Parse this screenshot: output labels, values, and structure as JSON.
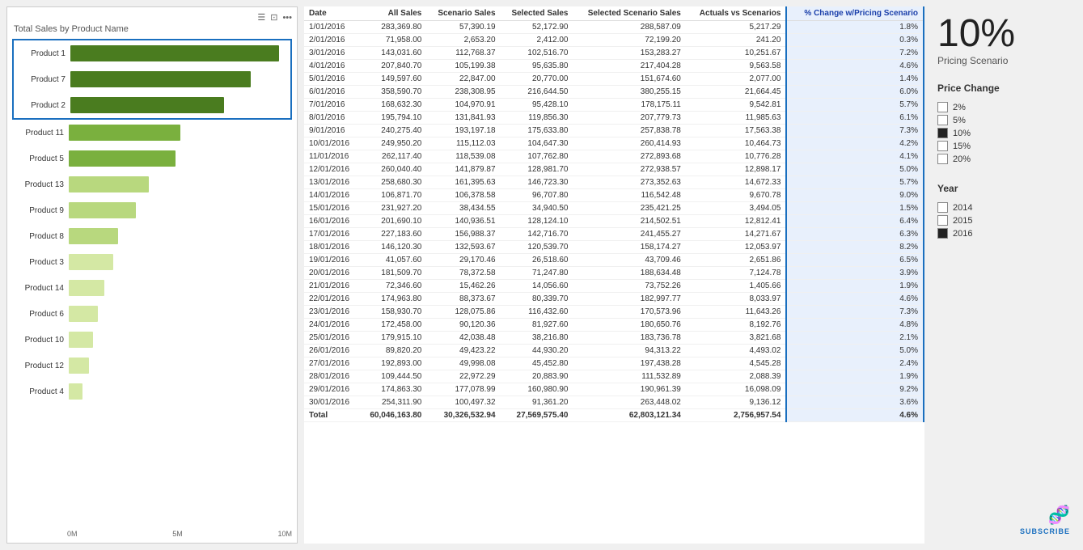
{
  "chart": {
    "title": "Total Sales by Product Name",
    "bars": [
      {
        "label": "Product 1",
        "width_pct": 95,
        "color": "dark-green",
        "highlighted": true
      },
      {
        "label": "Product 7",
        "width_pct": 82,
        "color": "dark-green",
        "highlighted": true
      },
      {
        "label": "Product 2",
        "width_pct": 70,
        "color": "dark-green",
        "highlighted": true
      },
      {
        "label": "Product 11",
        "width_pct": 50,
        "color": "med-green",
        "highlighted": false
      },
      {
        "label": "Product 5",
        "width_pct": 48,
        "color": "med-green",
        "highlighted": false
      },
      {
        "label": "Product 13",
        "width_pct": 36,
        "color": "light-green",
        "highlighted": false
      },
      {
        "label": "Product 9",
        "width_pct": 30,
        "color": "light-green",
        "highlighted": false
      },
      {
        "label": "Product 8",
        "width_pct": 22,
        "color": "light-green",
        "highlighted": false
      },
      {
        "label": "Product 3",
        "width_pct": 20,
        "color": "very-light-green",
        "highlighted": false
      },
      {
        "label": "Product 14",
        "width_pct": 16,
        "color": "very-light-green",
        "highlighted": false
      },
      {
        "label": "Product 6",
        "width_pct": 13,
        "color": "very-light-green",
        "highlighted": false
      },
      {
        "label": "Product 10",
        "width_pct": 11,
        "color": "very-light-green",
        "highlighted": false
      },
      {
        "label": "Product 12",
        "width_pct": 9,
        "color": "very-light-green",
        "highlighted": false
      },
      {
        "label": "Product 4",
        "width_pct": 6,
        "color": "very-light-green",
        "highlighted": false
      }
    ],
    "x_axis": [
      "0M",
      "5M",
      "10M"
    ]
  },
  "table": {
    "headers": [
      "Date",
      "All Sales",
      "Scenario Sales",
      "Selected Sales",
      "Selected Scenario Sales",
      "Actuals vs Scenarios",
      "% Change w/Pricing Scenario"
    ],
    "rows": [
      [
        "1/01/2016",
        "283,369.80",
        "57,390.19",
        "52,172.90",
        "288,587.09",
        "5,217.29",
        "1.8%"
      ],
      [
        "2/01/2016",
        "71,958.00",
        "2,653.20",
        "2,412.00",
        "72,199.20",
        "241.20",
        "0.3%"
      ],
      [
        "3/01/2016",
        "143,031.60",
        "112,768.37",
        "102,516.70",
        "153,283.27",
        "10,251.67",
        "7.2%"
      ],
      [
        "4/01/2016",
        "207,840.70",
        "105,199.38",
        "95,635.80",
        "217,404.28",
        "9,563.58",
        "4.6%"
      ],
      [
        "5/01/2016",
        "149,597.60",
        "22,847.00",
        "20,770.00",
        "151,674.60",
        "2,077.00",
        "1.4%"
      ],
      [
        "6/01/2016",
        "358,590.70",
        "238,308.95",
        "216,644.50",
        "380,255.15",
        "21,664.45",
        "6.0%"
      ],
      [
        "7/01/2016",
        "168,632.30",
        "104,970.91",
        "95,428.10",
        "178,175.11",
        "9,542.81",
        "5.7%"
      ],
      [
        "8/01/2016",
        "195,794.10",
        "131,841.93",
        "119,856.30",
        "207,779.73",
        "11,985.63",
        "6.1%"
      ],
      [
        "9/01/2016",
        "240,275.40",
        "193,197.18",
        "175,633.80",
        "257,838.78",
        "17,563.38",
        "7.3%"
      ],
      [
        "10/01/2016",
        "249,950.20",
        "115,112.03",
        "104,647.30",
        "260,414.93",
        "10,464.73",
        "4.2%"
      ],
      [
        "11/01/2016",
        "262,117.40",
        "118,539.08",
        "107,762.80",
        "272,893.68",
        "10,776.28",
        "4.1%"
      ],
      [
        "12/01/2016",
        "260,040.40",
        "141,879.87",
        "128,981.70",
        "272,938.57",
        "12,898.17",
        "5.0%"
      ],
      [
        "13/01/2016",
        "258,680.30",
        "161,395.63",
        "146,723.30",
        "273,352.63",
        "14,672.33",
        "5.7%"
      ],
      [
        "14/01/2016",
        "106,871.70",
        "106,378.58",
        "96,707.80",
        "116,542.48",
        "9,670.78",
        "9.0%"
      ],
      [
        "15/01/2016",
        "231,927.20",
        "38,434.55",
        "34,940.50",
        "235,421.25",
        "3,494.05",
        "1.5%"
      ],
      [
        "16/01/2016",
        "201,690.10",
        "140,936.51",
        "128,124.10",
        "214,502.51",
        "12,812.41",
        "6.4%"
      ],
      [
        "17/01/2016",
        "227,183.60",
        "156,988.37",
        "142,716.70",
        "241,455.27",
        "14,271.67",
        "6.3%"
      ],
      [
        "18/01/2016",
        "146,120.30",
        "132,593.67",
        "120,539.70",
        "158,174.27",
        "12,053.97",
        "8.2%"
      ],
      [
        "19/01/2016",
        "41,057.60",
        "29,170.46",
        "26,518.60",
        "43,709.46",
        "2,651.86",
        "6.5%"
      ],
      [
        "20/01/2016",
        "181,509.70",
        "78,372.58",
        "71,247.80",
        "188,634.48",
        "7,124.78",
        "3.9%"
      ],
      [
        "21/01/2016",
        "72,346.60",
        "15,462.26",
        "14,056.60",
        "73,752.26",
        "1,405.66",
        "1.9%"
      ],
      [
        "22/01/2016",
        "174,963.80",
        "88,373.67",
        "80,339.70",
        "182,997.77",
        "8,033.97",
        "4.6%"
      ],
      [
        "23/01/2016",
        "158,930.70",
        "128,075.86",
        "116,432.60",
        "170,573.96",
        "11,643.26",
        "7.3%"
      ],
      [
        "24/01/2016",
        "172,458.00",
        "90,120.36",
        "81,927.60",
        "180,650.76",
        "8,192.76",
        "4.8%"
      ],
      [
        "25/01/2016",
        "179,915.10",
        "42,038.48",
        "38,216.80",
        "183,736.78",
        "3,821.68",
        "2.1%"
      ],
      [
        "26/01/2016",
        "89,820.20",
        "49,423.22",
        "44,930.20",
        "94,313.22",
        "4,493.02",
        "5.0%"
      ],
      [
        "27/01/2016",
        "192,893.00",
        "49,998.08",
        "45,452.80",
        "197,438.28",
        "4,545.28",
        "2.4%"
      ],
      [
        "28/01/2016",
        "109,444.50",
        "22,972.29",
        "20,883.90",
        "111,532.89",
        "2,088.39",
        "1.9%"
      ],
      [
        "29/01/2016",
        "174,863.30",
        "177,078.99",
        "160,980.90",
        "190,961.39",
        "16,098.09",
        "9.2%"
      ],
      [
        "30/01/2016",
        "254,311.90",
        "100,497.32",
        "91,361.20",
        "263,448.02",
        "9,136.12",
        "3.6%"
      ]
    ],
    "total_row": [
      "Total",
      "60,046,163.80",
      "30,326,532.94",
      "27,569,575.40",
      "62,803,121.34",
      "2,756,957.54",
      "4.6%"
    ],
    "highlighted_col_index": 6
  },
  "controls": {
    "percentage_display": "10%",
    "pricing_scenario_label": "Pricing Scenario",
    "price_change_title": "Price Change",
    "price_change_options": [
      {
        "label": "2%",
        "checked": false
      },
      {
        "label": "5%",
        "checked": false
      },
      {
        "label": "10%",
        "checked": true
      },
      {
        "label": "15%",
        "checked": false
      },
      {
        "label": "20%",
        "checked": false
      }
    ],
    "year_title": "Year",
    "year_options": [
      {
        "label": "2014",
        "checked": false
      },
      {
        "label": "2015",
        "checked": false
      },
      {
        "label": "2016",
        "checked": true
      }
    ],
    "subscribe_text": "SUBSCRIBE"
  }
}
